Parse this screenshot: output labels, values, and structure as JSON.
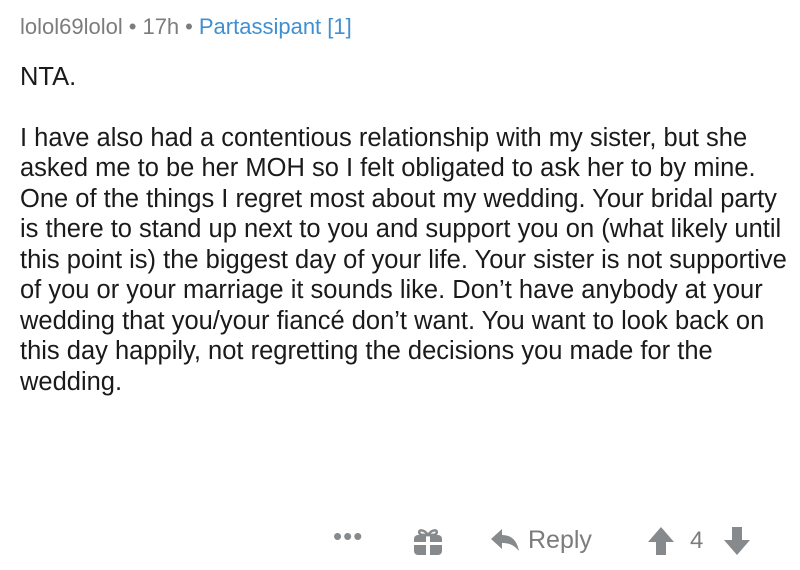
{
  "comment": {
    "username": "lolol69lolol",
    "separator": "•",
    "age": "17h",
    "flair": "Partassipant [1]",
    "paragraphs": [
      "NTA.",
      "I have also had a contentious relationship with my sister, but she asked me to be her MOH so I felt obligated to ask her to by mine. One of the things I regret most about my wedding. Your bridal party is there to stand up next to you and support you on (what likely until this point is) the biggest day of your life. Your sister is not supportive of you or your marriage it sounds like. Don’t have anybody at your wedding that you/your fiancé don’t want. You want to look back on this day happily, not regretting the decisions you made for the wedding."
    ]
  },
  "actions": {
    "more_label": "•••",
    "reply_label": "Reply",
    "score": "4"
  },
  "icons": {
    "more": "more-options-icon",
    "gift": "gift-award-icon",
    "reply": "reply-arrow-icon",
    "upvote": "upvote-arrow-icon",
    "downvote": "downvote-arrow-icon"
  },
  "colors": {
    "text": "#1a1a1b",
    "meta": "#7c7c7c",
    "flair": "#3f8fd1",
    "icon": "#878a8c"
  }
}
